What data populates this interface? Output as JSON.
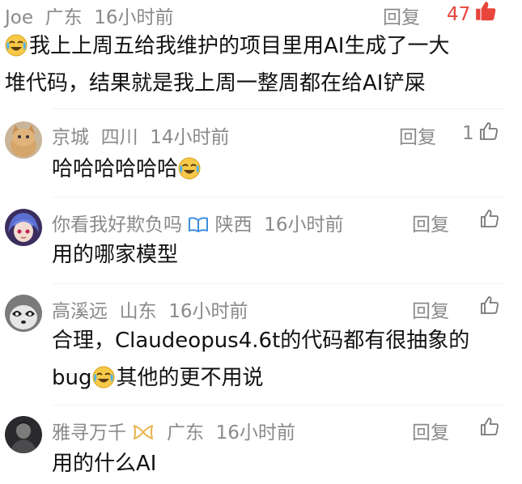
{
  "colors": {
    "meta": "#8a8a8a",
    "content": "#111111",
    "like_active": "#e8453c",
    "badge_blue": "#3c8ede",
    "badge_gold": "#e8b34a"
  },
  "comments": [
    {
      "username": "Joe",
      "location": "广东",
      "time": "16小时前",
      "reply_label": "回复",
      "like_count": "47",
      "liked": true,
      "line1": "我上上周五给我维护的项目里用AI生成了一大",
      "line2": "堆代码，结果就是我上周一整周都在给AI铲屎",
      "emoji": "laugh-cry-emoji"
    },
    {
      "username": "京城",
      "location": "四川",
      "time": "14小时前",
      "reply_label": "回复",
      "like_count": "1",
      "text": "哈哈哈哈哈哈",
      "emoji": "laugh-cry-emoji"
    },
    {
      "username": "你看我好欺负吗",
      "location": "陕西",
      "time": "16小时前",
      "reply_label": "回复",
      "like_count": "",
      "text": "用的哪家模型",
      "badge": "blue-book-icon"
    },
    {
      "username": "高溪远",
      "location": "山东",
      "time": "16小时前",
      "reply_label": "回复",
      "like_count": "",
      "line1": "合理，Claudeopus4.6t的代码都有很抽象的",
      "line2_before": "bug",
      "line2_after": "其他的更不用说",
      "emoji": "laugh-cry-emoji"
    },
    {
      "username": "雅寻万千",
      "location": "广东",
      "time": "16小时前",
      "reply_label": "回复",
      "like_count": "",
      "text": "用的什么AI",
      "badge": "gold-ribbon-icon"
    }
  ]
}
